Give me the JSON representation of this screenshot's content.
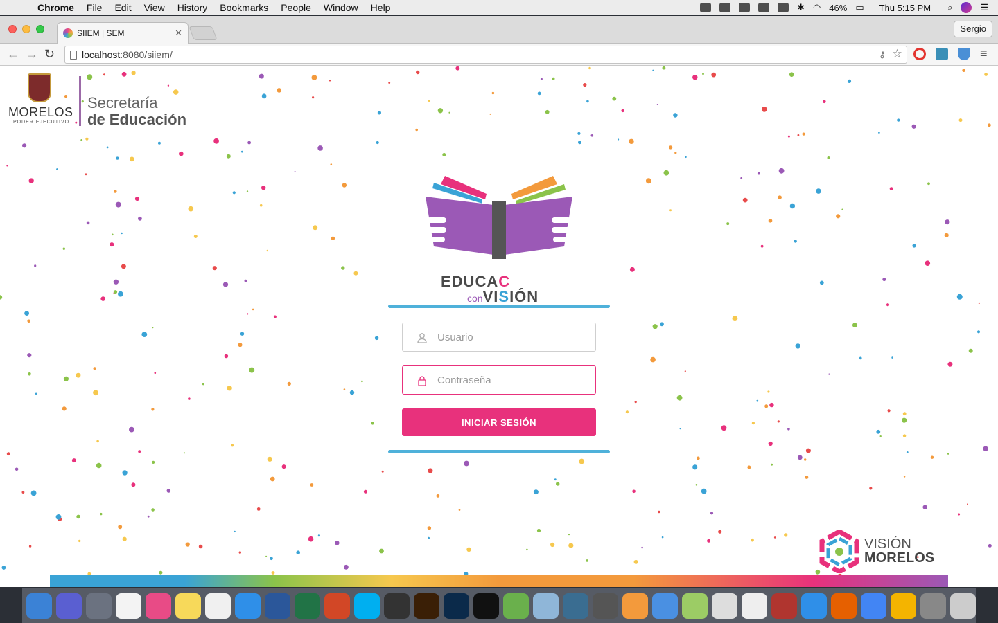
{
  "menubar": {
    "app_name": "Chrome",
    "items": [
      "File",
      "Edit",
      "View",
      "History",
      "Bookmarks",
      "People",
      "Window",
      "Help"
    ],
    "battery": "46%",
    "clock": "Thu 5:15 PM"
  },
  "browser": {
    "tab_title": "SIIEM | SEM",
    "profile": "Sergio",
    "url_host": "localhost",
    "url_rest": ":8080/siiem/"
  },
  "header": {
    "morelos": "MORELOS",
    "poder": "PODER EJECUTIVO",
    "secretaria": "Secretaría",
    "educacion": "de Educación"
  },
  "brand": {
    "educa": "EDUCA",
    "c": "C",
    "con": "con",
    "vi": "VI",
    "s": "S",
    "ion": "IÓN"
  },
  "login": {
    "user_placeholder": "Usuario",
    "password_placeholder": "Contraseña",
    "submit_label": "INICIAR SESIÓN"
  },
  "footer": {
    "vision": "VISIÓN",
    "morelos": "MORELOS"
  },
  "colors": {
    "accent": "#e8317c",
    "bar": "#4fb1da",
    "purple": "#9b59b6"
  },
  "dock_apps": [
    "finder-icon",
    "siri-icon",
    "launchpad-icon",
    "calendar-icon",
    "itunes-icon",
    "notes-icon",
    "textedit-icon",
    "appstore-icon",
    "word-icon",
    "excel-icon",
    "powerpoint-icon",
    "skype-icon",
    "safari-compass-icon",
    "illustrator-icon",
    "photoshop-icon",
    "terminal-icon",
    "spring-icon",
    "virtualbox-icon",
    "mysql-icon",
    "sequelpro-icon",
    "sublime-icon",
    "xcode-icon",
    "android-studio-icon",
    "scanner-icon",
    "script-icon",
    "filezilla-icon",
    "safari-icon",
    "firefox-icon",
    "chrome-icon",
    "drive-icon",
    "preferences-icon",
    "trash-icon"
  ]
}
